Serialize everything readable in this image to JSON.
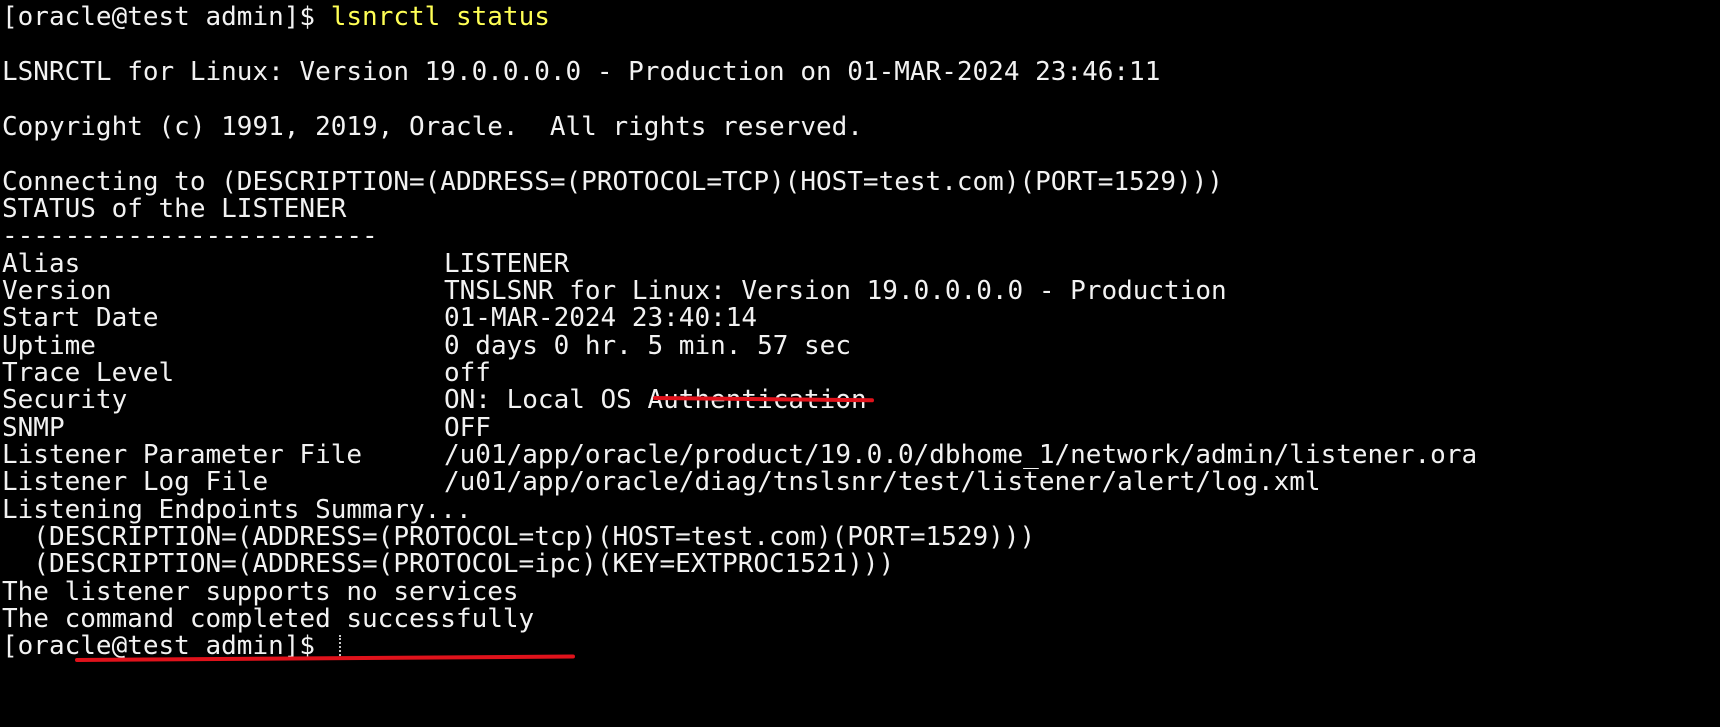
{
  "terminal": {
    "prompt1": "[oracle@test admin]$ ",
    "command": "lsnrctl status",
    "banner": "LSNRCTL for Linux: Version 19.0.0.0.0 - Production on 01-MAR-2024 23:46:11",
    "copyright": "Copyright (c) 1991, 2019, Oracle.  All rights reserved.",
    "connecting": "Connecting to (DESCRIPTION=(ADDRESS=(PROTOCOL=TCP)(HOST=test.com)(PORT=1529)))",
    "status_header": "STATUS of the LISTENER",
    "separator": "------------------------",
    "fields": [
      {
        "label": "Alias",
        "value": "LISTENER"
      },
      {
        "label": "Version",
        "value": "TNSLSNR for Linux: Version 19.0.0.0.0 - Production"
      },
      {
        "label": "Start Date",
        "value": "01-MAR-2024 23:40:14"
      },
      {
        "label": "Uptime",
        "value": "0 days 0 hr. 5 min. 57 sec"
      },
      {
        "label": "Trace Level",
        "value": "off"
      },
      {
        "label": "Security",
        "value": "ON: Local OS Authentication"
      },
      {
        "label": "SNMP",
        "value": "OFF"
      },
      {
        "label": "Listener Parameter File",
        "value": "/u01/app/oracle/product/19.0.0/dbhome_1/network/admin/listener.ora"
      },
      {
        "label": "Listener Log File",
        "value": "/u01/app/oracle/diag/tnslsnr/test/listener/alert/log.xml"
      }
    ],
    "endpoints_header": "Listening Endpoints Summary...",
    "endpoint1": "  (DESCRIPTION=(ADDRESS=(PROTOCOL=tcp)(HOST=test.com)(PORT=1529)))",
    "endpoint2": "  (DESCRIPTION=(ADDRESS=(PROTOCOL=ipc)(KEY=EXTPROC1521)))",
    "no_services": "The listener supports no services",
    "completed": "The command completed successfully",
    "prompt2": "[oracle@test admin]$ "
  },
  "colors": {
    "background": "#000000",
    "text": "#f2f2f2",
    "command": "#ffff55",
    "annotation": "#e0121b"
  }
}
